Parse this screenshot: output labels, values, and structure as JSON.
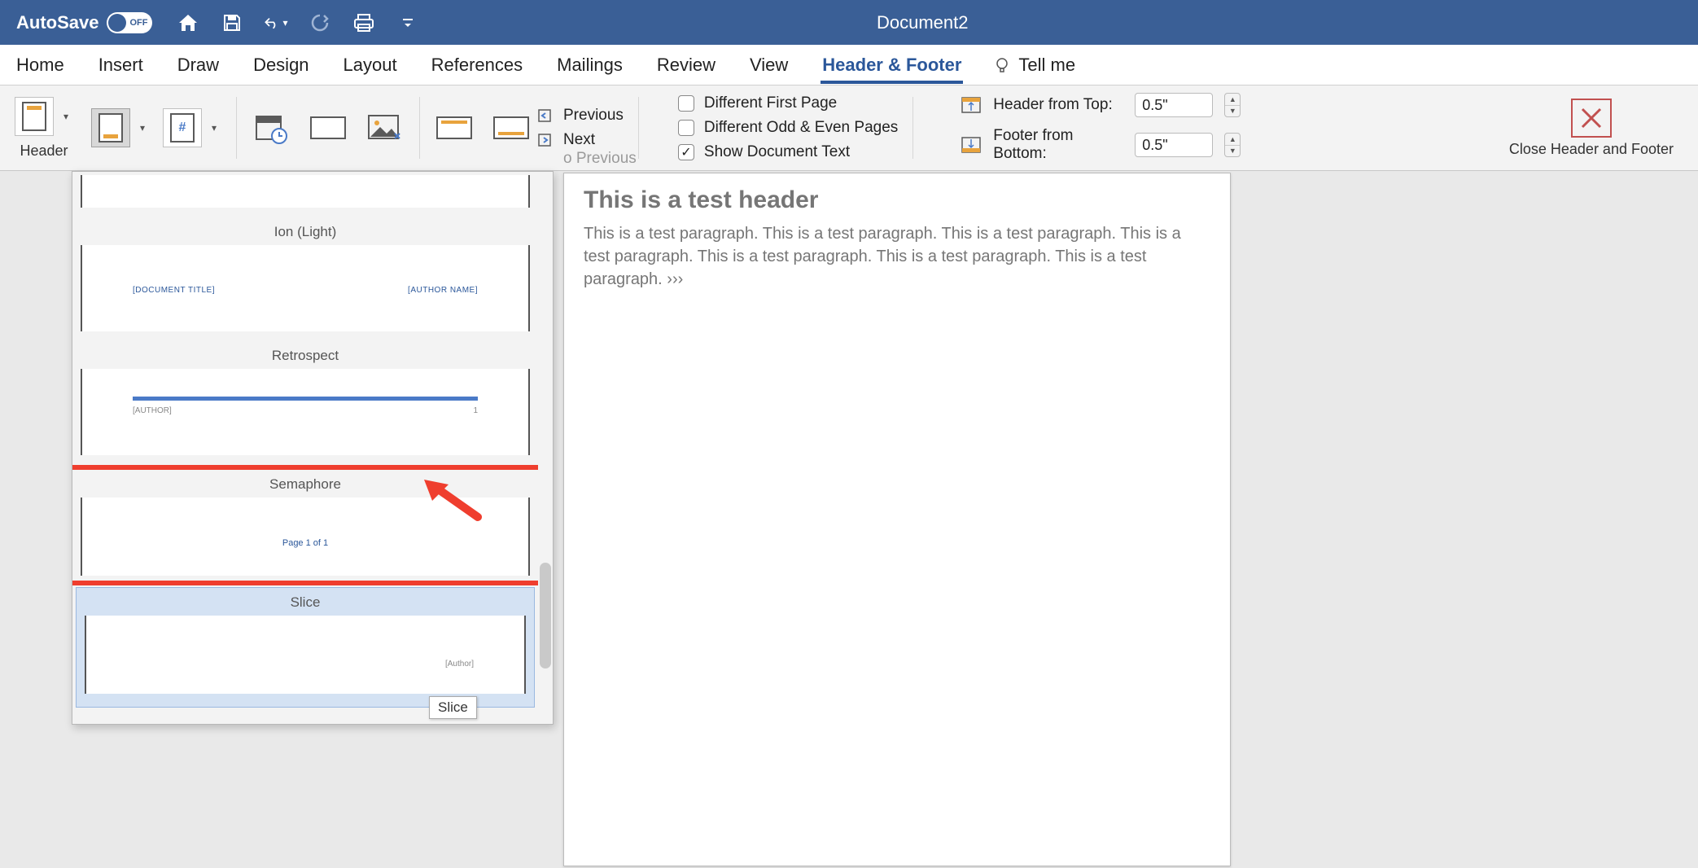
{
  "titlebar": {
    "autosave_label": "AutoSave",
    "autosave_state": "OFF",
    "document_title": "Document2"
  },
  "tabs": {
    "home": "Home",
    "insert": "Insert",
    "draw": "Draw",
    "design": "Design",
    "layout": "Layout",
    "references": "References",
    "mailings": "Mailings",
    "review": "Review",
    "view": "View",
    "header_footer": "Header & Footer",
    "tell_me": "Tell me"
  },
  "ribbon": {
    "header_label": "Header",
    "nav_previous": "Previous",
    "nav_next": "Next",
    "go_to_previous": "o Previous",
    "opt_first_page": "Different First Page",
    "opt_odd_even": "Different Odd & Even Pages",
    "opt_show_doc": "Show Document Text",
    "header_from_top": "Header from Top:",
    "footer_from_bottom": "Footer from Bottom:",
    "header_value": "0.5\"",
    "footer_value": "0.5\"",
    "close_label": "Close Header and Footer"
  },
  "gallery": {
    "items": {
      "ion_light": {
        "title": "Ion (Light)",
        "doc_title": "[DOCUMENT TITLE]",
        "author": "[AUTHOR NAME]"
      },
      "retrospect": {
        "title": "Retrospect",
        "author": "[AUTHOR]",
        "page": "1"
      },
      "semaphore": {
        "title": "Semaphore",
        "page_text": "Page 1 of 1"
      },
      "slice": {
        "title": "Slice",
        "author": "[Author]"
      }
    },
    "tooltip": "Slice"
  },
  "document": {
    "header_text": "This is a test header",
    "body_text": "This is a test paragraph. This is a test paragraph. This is a test paragraph. This is a test paragraph. This is a test paragraph. This is a test paragraph. This is a test paragraph. ›››"
  }
}
